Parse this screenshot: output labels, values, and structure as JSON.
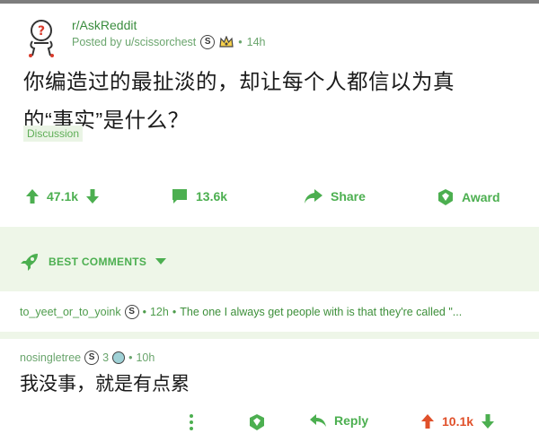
{
  "post": {
    "subreddit": "r/AskReddit",
    "posted_by": "Posted by u/scissorchest",
    "badge_letter": "S",
    "age": "14h",
    "title_line1": "你编造过的最扯淡的，却让每个人都信以为真",
    "title_line2": "的“事实”是什么？",
    "flair": "Discussion",
    "upvotes": "47.1k",
    "comments": "13.6k",
    "share_label": "Share",
    "award_label": "Award"
  },
  "best_comments_label": "BEST COMMENTS",
  "comment1": {
    "author": "to_yeet_or_to_yoink",
    "badge_letter": "S",
    "age": "12h",
    "preview": "The one I always get people with is that they're called \"..."
  },
  "comment2": {
    "author": "nosingletree",
    "badge_letter": "S",
    "badge_count": "3",
    "age": "10h",
    "body": "我没事，就是有点累",
    "reply_label": "Reply",
    "score": "10.1k"
  },
  "colors": {
    "accent": "#4caf50",
    "upvote_active": "#e0502a",
    "band": "#eef6e8"
  }
}
